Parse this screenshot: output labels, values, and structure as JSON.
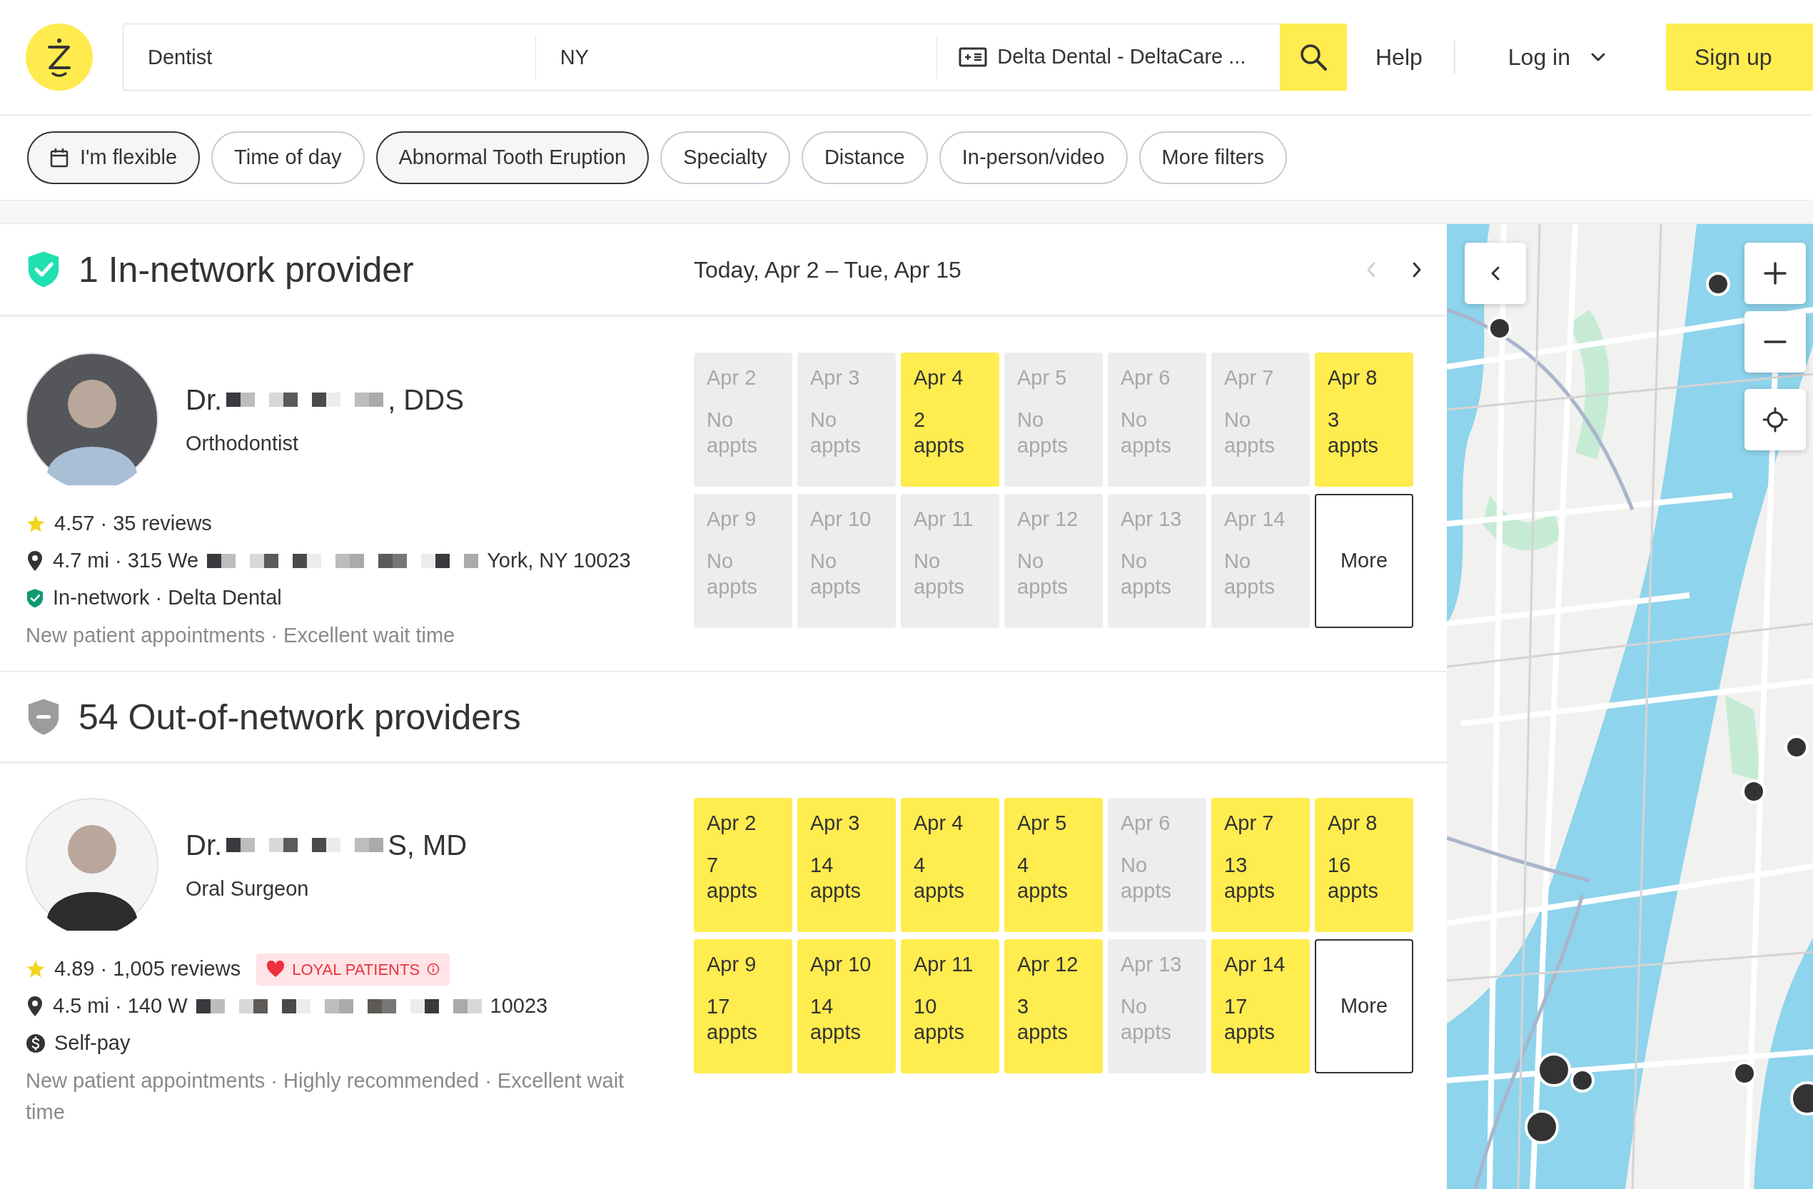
{
  "header": {
    "specialty": "Dentist",
    "location": "NY",
    "insurance": "Delta Dental - DeltaCare ...",
    "help": "Help",
    "login": "Log in",
    "signup": "Sign up"
  },
  "filters": [
    {
      "label": "I'm flexible",
      "kind": "date",
      "selected": true
    },
    {
      "label": "Time of day",
      "kind": "filter",
      "selected": false
    },
    {
      "label": "Abnormal Tooth Eruption",
      "kind": "filter",
      "selected": true
    },
    {
      "label": "Specialty",
      "kind": "filter",
      "selected": false
    },
    {
      "label": "Distance",
      "kind": "filter",
      "selected": false
    },
    {
      "label": "In-person/video",
      "kind": "filter",
      "selected": false
    },
    {
      "label": "More filters",
      "kind": "filter",
      "selected": false
    }
  ],
  "sections": [
    {
      "kind": "in_network",
      "title": "1 In-network provider",
      "date_range": "Today, Apr 2 – Tue, Apr 15",
      "nav": [
        {
          "kind": "prev",
          "disabled": true
        },
        {
          "kind": "next",
          "disabled": false
        }
      ],
      "providers": [
        {
          "name_start": "Dr.",
          "name_end": ", DDS",
          "redacted": true,
          "specialty": "Orthodontist",
          "rating": "4.57 · 35 reviews",
          "distance": "4.7 mi · 315 We",
          "address_end": "York, NY 10023",
          "coverage": {
            "kind": "in_network",
            "label": "In-network · Delta Dental"
          },
          "highlights": "New patient appointments · Excellent wait time",
          "more": "More",
          "slots": [
            {
              "date": "Apr 2",
              "availability": "No appts",
              "available": false
            },
            {
              "date": "Apr 3",
              "availability": "No appts",
              "available": false
            },
            {
              "date": "Apr 4",
              "availability": "2 appts",
              "available": true
            },
            {
              "date": "Apr 5",
              "availability": "No appts",
              "available": false
            },
            {
              "date": "Apr 6",
              "availability": "No appts",
              "available": false
            },
            {
              "date": "Apr 7",
              "availability": "No appts",
              "available": false
            },
            {
              "date": "Apr 8",
              "availability": "3 appts",
              "available": true
            },
            {
              "date": "Apr 9",
              "availability": "No appts",
              "available": false
            },
            {
              "date": "Apr 10",
              "availability": "No appts",
              "available": false
            },
            {
              "date": "Apr 11",
              "availability": "No appts",
              "available": false
            },
            {
              "date": "Apr 12",
              "availability": "No appts",
              "available": false
            },
            {
              "date": "Apr 13",
              "availability": "No appts",
              "available": false
            },
            {
              "date": "Apr 14",
              "availability": "No appts",
              "available": false
            }
          ]
        }
      ]
    },
    {
      "kind": "out_of_network",
      "title": "54 Out-of-network providers",
      "providers": [
        {
          "name_start": "Dr.",
          "name_end": "S, MD",
          "redacted": true,
          "specialty": "Oral Surgeon",
          "rating": "4.89 · 1,005 reviews",
          "badge": "LOYAL PATIENTS",
          "distance": "4.5 mi · 140 W",
          "address_end": "10023",
          "coverage": {
            "kind": "self_pay",
            "label": "Self-pay"
          },
          "highlights": "New patient appointments · Highly recommended · Excellent wait time",
          "more": "More",
          "slots": [
            {
              "date": "Apr 2",
              "availability": "7 appts",
              "available": true
            },
            {
              "date": "Apr 3",
              "availability": "14 appts",
              "available": true
            },
            {
              "date": "Apr 4",
              "availability": "4 appts",
              "available": true
            },
            {
              "date": "Apr 5",
              "availability": "4 appts",
              "available": true
            },
            {
              "date": "Apr 6",
              "availability": "No appts",
              "available": false
            },
            {
              "date": "Apr 7",
              "availability": "13 appts",
              "available": true
            },
            {
              "date": "Apr 8",
              "availability": "16 appts",
              "available": true
            },
            {
              "date": "Apr 9",
              "availability": "17 appts",
              "available": true
            },
            {
              "date": "Apr 10",
              "availability": "14 appts",
              "available": true
            },
            {
              "date": "Apr 11",
              "availability": "10 appts",
              "available": true
            },
            {
              "date": "Apr 12",
              "availability": "3 appts",
              "available": true
            },
            {
              "date": "Apr 13",
              "availability": "No appts",
              "available": false
            },
            {
              "date": "Apr 14",
              "availability": "17 appts",
              "available": true
            }
          ]
        }
      ]
    }
  ]
}
